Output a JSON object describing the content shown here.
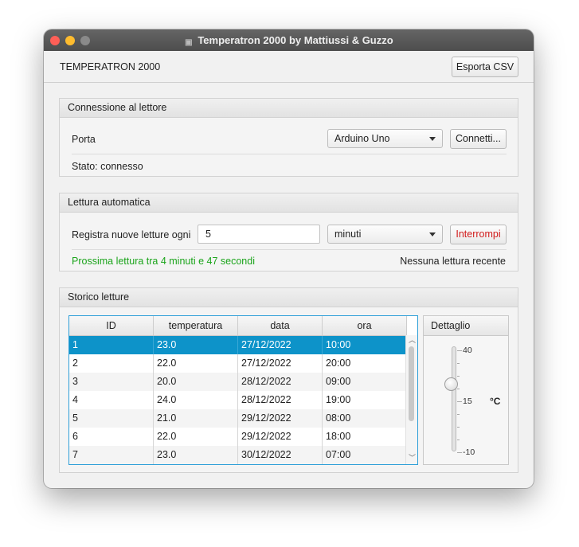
{
  "window": {
    "title": "Temperatron 2000 by Mattiussi & Guzzo"
  },
  "topbar": {
    "title": "TEMPERATRON 2000",
    "export_label": "Esporta CSV"
  },
  "connection": {
    "header": "Connessione al lettore",
    "port_label": "Porta",
    "port_value": "Arduino Uno",
    "connect_label": "Connetti...",
    "status": "Stato: connesso"
  },
  "auto_read": {
    "header": "Lettura automatica",
    "interval_label": "Registra nuove letture ogni",
    "interval_value": "5",
    "unit_value": "minuti",
    "stop_label": "Interrompi",
    "next_reading": "Prossima lettura tra 4 minuti e 47 secondi",
    "recent": "Nessuna lettura recente",
    "next_reading_color": "#1aa41a",
    "stop_color": "#d11a1a"
  },
  "history": {
    "header": "Storico letture",
    "columns": [
      "ID",
      "temperatura",
      "data",
      "ora"
    ],
    "rows": [
      [
        "1",
        "23.0",
        "27/12/2022",
        "10:00"
      ],
      [
        "2",
        "22.0",
        "27/12/2022",
        "20:00"
      ],
      [
        "3",
        "20.0",
        "28/12/2022",
        "09:00"
      ],
      [
        "4",
        "24.0",
        "28/12/2022",
        "19:00"
      ],
      [
        "5",
        "21.0",
        "29/12/2022",
        "08:00"
      ],
      [
        "6",
        "22.0",
        "29/12/2022",
        "18:00"
      ],
      [
        "7",
        "23.0",
        "30/12/2022",
        "07:00"
      ]
    ],
    "selected_row": 0,
    "selection_color": "#0d93c9"
  },
  "detail": {
    "header": "Dettaglio",
    "scale_max": "40",
    "scale_mid": "15",
    "scale_min": "-10",
    "unit": "°C",
    "value": 23.0
  }
}
